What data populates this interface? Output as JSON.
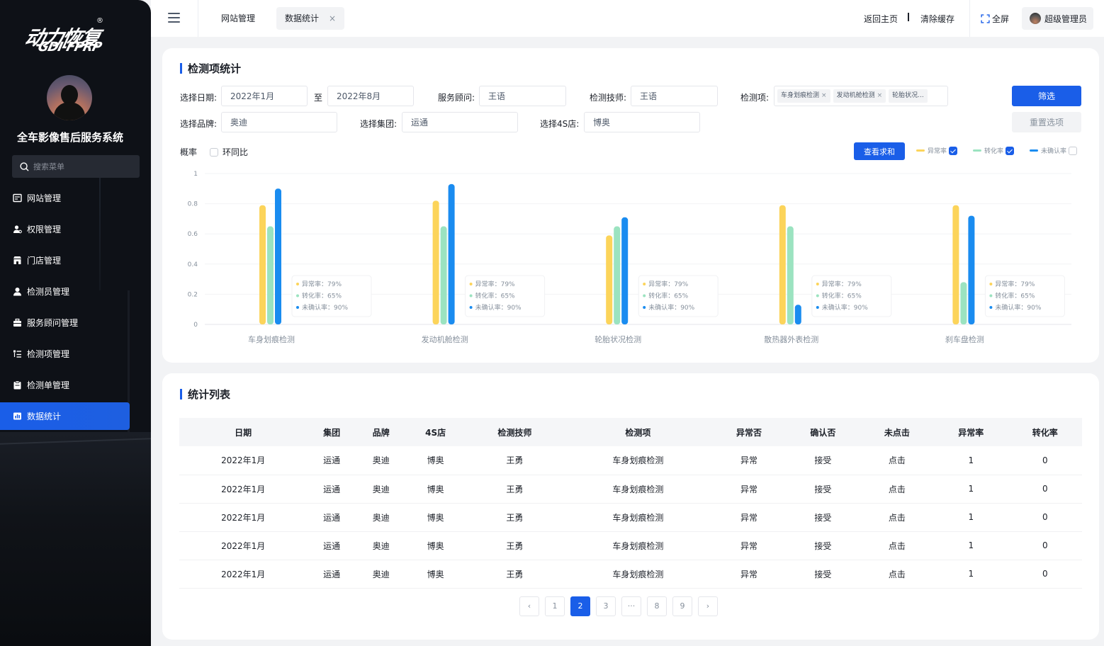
{
  "brand": {
    "logo_main": "动力恢复",
    "logo_sub": "GDI-FPRP",
    "logo_reg": "®",
    "system_title": "全车影像售后服务系统"
  },
  "sidebar": {
    "search_placeholder": "搜索菜单",
    "items": [
      {
        "label": "网站管理",
        "icon": "site-icon"
      },
      {
        "label": "权限管理",
        "icon": "permission-icon"
      },
      {
        "label": "门店管理",
        "icon": "store-icon"
      },
      {
        "label": "检测员管理",
        "icon": "inspector-icon"
      },
      {
        "label": "服务顾问管理",
        "icon": "briefcase-icon"
      },
      {
        "label": "检测项管理",
        "icon": "list-icon"
      },
      {
        "label": "检测单管理",
        "icon": "clipboard-icon"
      },
      {
        "label": "数据统计",
        "icon": "chart-icon",
        "active": true
      }
    ]
  },
  "topbar": {
    "tabs": [
      {
        "label": "网站管理"
      },
      {
        "label": "数据统计",
        "close": "×",
        "active": true
      }
    ],
    "back_home": "返回主页",
    "clear_cache": "清除缓存",
    "fullscreen": "全屏",
    "user": "超级管理员"
  },
  "stats": {
    "title": "检测项统计",
    "filters": {
      "date_label": "选择日期:",
      "date_from": "2022年1月",
      "date_to_sep": "至",
      "date_to": "2022年8月",
      "advisor_label": "服务顾问:",
      "advisor": "王语",
      "tech_label": "检测技师:",
      "tech": "王语",
      "items_label": "检测项:",
      "item_tags": [
        "车身划痕检测",
        "发动机舱检测",
        "轮胎状况..."
      ],
      "tag_close": "×",
      "brand_label": "选择品牌:",
      "brand": "奥迪",
      "group_label": "选择集团:",
      "group": "运通",
      "store_label": "选择4S店:",
      "store": "博奥",
      "filter_btn": "筛选",
      "reset_btn": "重置选项"
    },
    "mode_label": "概率",
    "yoy_label": "环同比",
    "sum_btn": "查看求和",
    "legend": [
      {
        "name": "异常率",
        "color": "#fcd45a",
        "checked": true
      },
      {
        "name": "转化率",
        "color": "#9be3c0",
        "checked": true
      },
      {
        "name": "未确认率",
        "color": "#1a8cf0",
        "checked": false
      }
    ]
  },
  "chart_data": {
    "type": "bar",
    "categories": [
      "车身划痕检测",
      "发动机舱检测",
      "轮胎状况检测",
      "散热器外表检测",
      "刹车盘检测"
    ],
    "series": [
      {
        "name": "异常率",
        "values": [
          0.79,
          0.82,
          0.59,
          0.79,
          0.79
        ]
      },
      {
        "name": "转化率",
        "values": [
          0.65,
          0.65,
          0.65,
          0.65,
          0.28
        ]
      },
      {
        "name": "未确认率",
        "values": [
          0.9,
          0.93,
          0.71,
          0.13,
          0.72
        ]
      }
    ],
    "ylim": [
      0,
      1
    ],
    "yticks": [
      "0",
      "0.2",
      "0.4",
      "0.6",
      "0.8",
      "1"
    ],
    "tooltips": [
      [
        "异常率：79%",
        "转化率：65%",
        "未确认率：90%"
      ],
      [
        "异常率：79%",
        "转化率：65%",
        "未确认率：90%"
      ],
      [
        "异常率：79%",
        "转化率：65%",
        "未确认率：90%"
      ],
      [
        "异常率：79%",
        "转化率：65%",
        "未确认率：90%"
      ],
      [
        "异常率：79%",
        "转化率：65%",
        "未确认率：90%"
      ]
    ],
    "colors": [
      "#fcd45a",
      "#9be3c0",
      "#1a8cf0"
    ],
    "grid": true
  },
  "list": {
    "title": "统计列表",
    "headers": [
      "日期",
      "集团",
      "品牌",
      "4S店",
      "检测技师",
      "检测项",
      "异常否",
      "确认否",
      "未点击",
      "异常率",
      "转化率"
    ],
    "rows": [
      [
        "2022年1月",
        "运通",
        "奥迪",
        "博奥",
        "王勇",
        "车身划痕检测",
        "异常",
        "接受",
        "点击",
        "1",
        "0"
      ],
      [
        "2022年1月",
        "运通",
        "奥迪",
        "博奥",
        "王勇",
        "车身划痕检测",
        "异常",
        "接受",
        "点击",
        "1",
        "0"
      ],
      [
        "2022年1月",
        "运通",
        "奥迪",
        "博奥",
        "王勇",
        "车身划痕检测",
        "异常",
        "接受",
        "点击",
        "1",
        "0"
      ],
      [
        "2022年1月",
        "运通",
        "奥迪",
        "博奥",
        "王勇",
        "车身划痕检测",
        "异常",
        "接受",
        "点击",
        "1",
        "0"
      ],
      [
        "2022年1月",
        "运通",
        "奥迪",
        "博奥",
        "王勇",
        "车身划痕检测",
        "异常",
        "接受",
        "点击",
        "1",
        "0"
      ]
    ],
    "pagination": {
      "prev": "‹",
      "next": "›",
      "pages": [
        "1",
        "2",
        "3",
        "···",
        "8",
        "9"
      ],
      "current": "2"
    }
  }
}
